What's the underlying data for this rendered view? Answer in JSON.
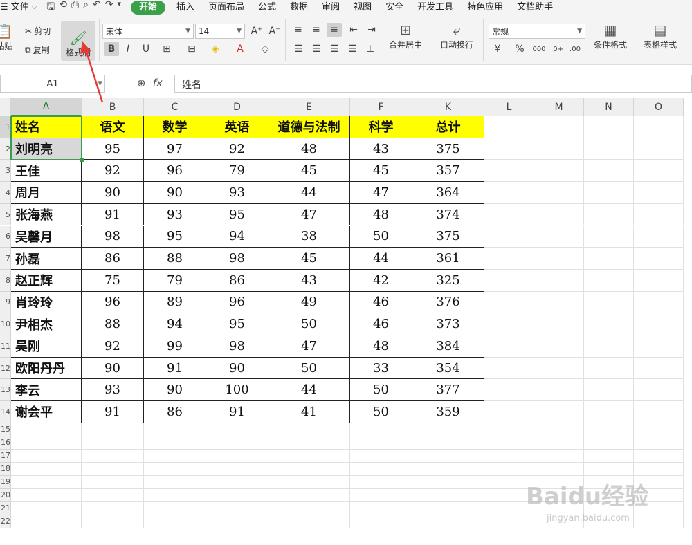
{
  "menu": {
    "file": "文件",
    "tabs": [
      "开始",
      "插入",
      "页面布局",
      "公式",
      "数据",
      "审阅",
      "视图",
      "安全",
      "开发工具",
      "特色应用",
      "文档助手"
    ],
    "active_tab": "开始"
  },
  "ribbon": {
    "paste": "粘贴",
    "cut": "剪切",
    "copy": "复制",
    "format_painter": "格式刷",
    "font_name": "宋体",
    "font_size": "14",
    "bold": "B",
    "italic": "I",
    "underline": "U",
    "merge_center": "合并居中",
    "wrap_text": "自动换行",
    "number_format": "常规",
    "conditional_format": "条件格式",
    "table_style": "表格样式"
  },
  "formula_bar": {
    "name_box": "A1",
    "fx": "fx",
    "value": "姓名"
  },
  "columns": [
    "A",
    "B",
    "C",
    "D",
    "E",
    "F",
    "K",
    "L",
    "M",
    "N",
    "O"
  ],
  "rows": [
    "1",
    "2",
    "3",
    "4",
    "5",
    "6",
    "7",
    "8",
    "9",
    "10",
    "11",
    "12",
    "13",
    "14",
    "15",
    "16",
    "17",
    "18",
    "19",
    "20",
    "21",
    "22"
  ],
  "table": {
    "headers": [
      "姓名",
      "语文",
      "数学",
      "英语",
      "道德与法制",
      "科学",
      "总计"
    ],
    "rows": [
      [
        "刘明亮",
        "95",
        "97",
        "92",
        "48",
        "43",
        "375"
      ],
      [
        "王佳",
        "92",
        "96",
        "79",
        "45",
        "45",
        "357"
      ],
      [
        "周月",
        "90",
        "90",
        "93",
        "44",
        "47",
        "364"
      ],
      [
        "张海燕",
        "91",
        "93",
        "95",
        "47",
        "48",
        "374"
      ],
      [
        "吴馨月",
        "98",
        "95",
        "94",
        "38",
        "50",
        "375"
      ],
      [
        "孙磊",
        "86",
        "88",
        "98",
        "45",
        "44",
        "361"
      ],
      [
        "赵正辉",
        "75",
        "79",
        "86",
        "43",
        "42",
        "325"
      ],
      [
        "肖玲玲",
        "96",
        "89",
        "96",
        "49",
        "46",
        "376"
      ],
      [
        "尹相杰",
        "88",
        "94",
        "95",
        "50",
        "46",
        "373"
      ],
      [
        "吴刚",
        "92",
        "99",
        "98",
        "47",
        "48",
        "384"
      ],
      [
        "欧阳丹丹",
        "90",
        "91",
        "90",
        "50",
        "33",
        "354"
      ],
      [
        "李云",
        "93",
        "90",
        "100",
        "44",
        "50",
        "377"
      ],
      [
        "谢会平",
        "91",
        "86",
        "91",
        "41",
        "50",
        "359"
      ]
    ]
  },
  "colors": {
    "header_fill": "#ffff00",
    "selection": "#3a9c4e",
    "accent_tab": "#3aa14a",
    "annotation_arrow": "#e53935"
  },
  "watermark": {
    "logo": "Baidu经验",
    "url": "jingyan.baidu.com"
  }
}
